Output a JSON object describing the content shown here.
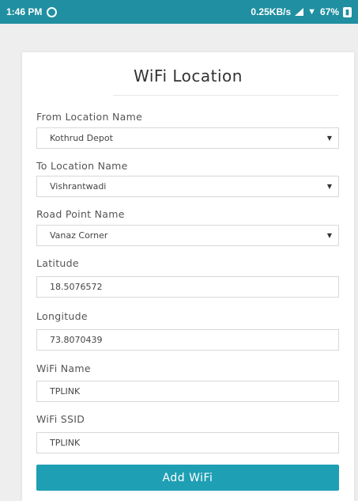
{
  "status_bar": {
    "time": "1:46 PM",
    "network_speed": "0.25KB/s",
    "battery": "67%",
    "left_icon": "whatsapp-icon",
    "icons": [
      "signal-icon",
      "wifi-icon",
      "battery-icon"
    ]
  },
  "form": {
    "title": "WiFi Location",
    "from_location": {
      "label": "From Location Name",
      "value": "Kothrud Depot"
    },
    "to_location": {
      "label": "To Location Name",
      "value": "Vishrantwadi"
    },
    "road_point": {
      "label": "Road Point Name",
      "value": "Vanaz Corner"
    },
    "latitude": {
      "label": "Latitude",
      "value": "18.5076572"
    },
    "longitude": {
      "label": "Longitude",
      "value": "73.8070439"
    },
    "wifi_name": {
      "label": "WiFi Name",
      "value": "TPLINK"
    },
    "wifi_ssid": {
      "label": "WiFi SSID",
      "value": "TPLINK"
    },
    "submit_label": "Add WiFi",
    "accent_color": "#1f9fb4",
    "caret_glyph": "▼"
  }
}
